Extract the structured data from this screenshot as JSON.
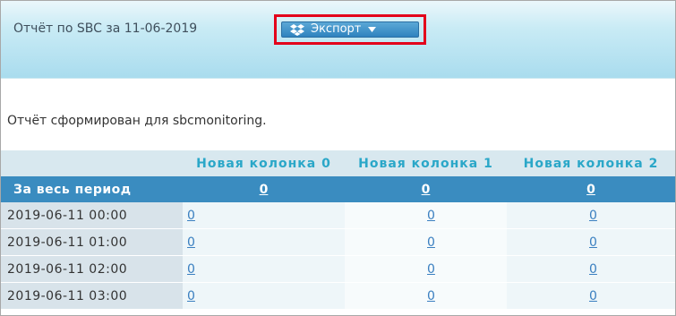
{
  "header": {
    "report_title": "Отчёт по SBC за 11-06-2019",
    "export_label": "Экспорт",
    "export_icon": "dropbox-icon",
    "dropdown_icon": "caret-down-icon",
    "highlight_color": "#e3001b"
  },
  "main": {
    "generated_text": "Отчёт сформирован для sbcmonitoring."
  },
  "table": {
    "columns": [
      "Новая колонка 0",
      "Новая колонка 1",
      "Новая колонка 2"
    ],
    "total_row": {
      "label": "За весь период",
      "values": [
        "0",
        "0",
        "0"
      ]
    },
    "rows": [
      {
        "label": "2019-06-11 00:00",
        "values": [
          "0",
          "0",
          "0"
        ]
      },
      {
        "label": "2019-06-11 01:00",
        "values": [
          "0",
          "0",
          "0"
        ]
      },
      {
        "label": "2019-06-11 02:00",
        "values": [
          "0",
          "0",
          "0"
        ]
      },
      {
        "label": "2019-06-11 03:00",
        "values": [
          "0",
          "0",
          "0"
        ]
      }
    ]
  },
  "colors": {
    "header_accent": "#2aa7c8",
    "total_row_bg": "#3a8cc0",
    "link": "#3a7fc0"
  }
}
